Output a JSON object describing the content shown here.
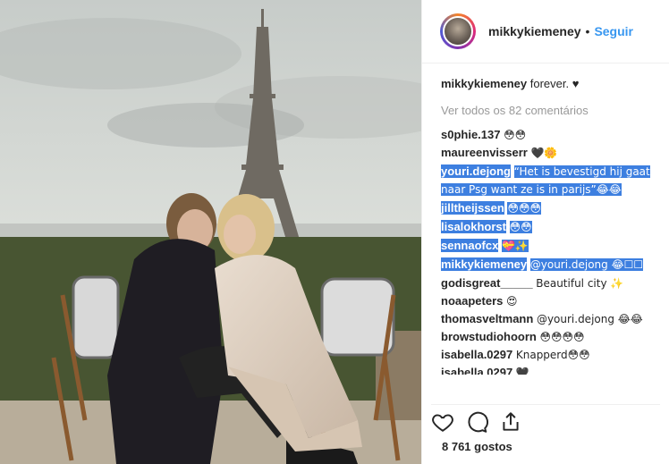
{
  "post": {
    "username": "mikkykiemeney",
    "dot": "•",
    "follow_label": "Seguir",
    "caption_user": "mikkykiemeney",
    "caption_text": "forever. ♥",
    "view_all_label": "Ver todos os 82 comentários",
    "likes_label": "8 761 gostos"
  },
  "comments": [
    {
      "user": "s0phie.137",
      "text": "😳😳",
      "selected": false
    },
    {
      "user": "maureenvisserr",
      "text": "🖤🌼",
      "selected": false
    },
    {
      "user": "youri.dejong",
      "text": "“Het is bevestigd hij gaat naar Psg want ze is in parijs”😂😂",
      "selected": true
    },
    {
      "user": "jilltheijssen",
      "text": "😳😳😳",
      "selected": true
    },
    {
      "user": "lisalokhorst",
      "text": "😳😳",
      "selected": true
    },
    {
      "user": "sennaofcx",
      "text": "💝✨",
      "selected": true
    },
    {
      "user": "mikkykiemeney",
      "text": "@youri.dejong 😂☐☐",
      "selected": true
    },
    {
      "user": "godisgreat_____",
      "text": "Beautiful city ✨",
      "selected": false
    },
    {
      "user": "noaapeters",
      "text": "😍",
      "selected": false
    },
    {
      "user": "thomasveltmann",
      "text": "@youri.dejong 😂😂",
      "selected": false
    },
    {
      "user": "browstudiohoorn",
      "text": "😳😳😳😳",
      "selected": false
    },
    {
      "user": "isabella.0297",
      "text": "Knapperd😳😳",
      "selected": false
    },
    {
      "user": "isabella.0297",
      "text": "🖤",
      "selected": false
    }
  ],
  "icons": {
    "like": "heart-icon",
    "comment": "comment-icon",
    "share": "share-icon"
  }
}
